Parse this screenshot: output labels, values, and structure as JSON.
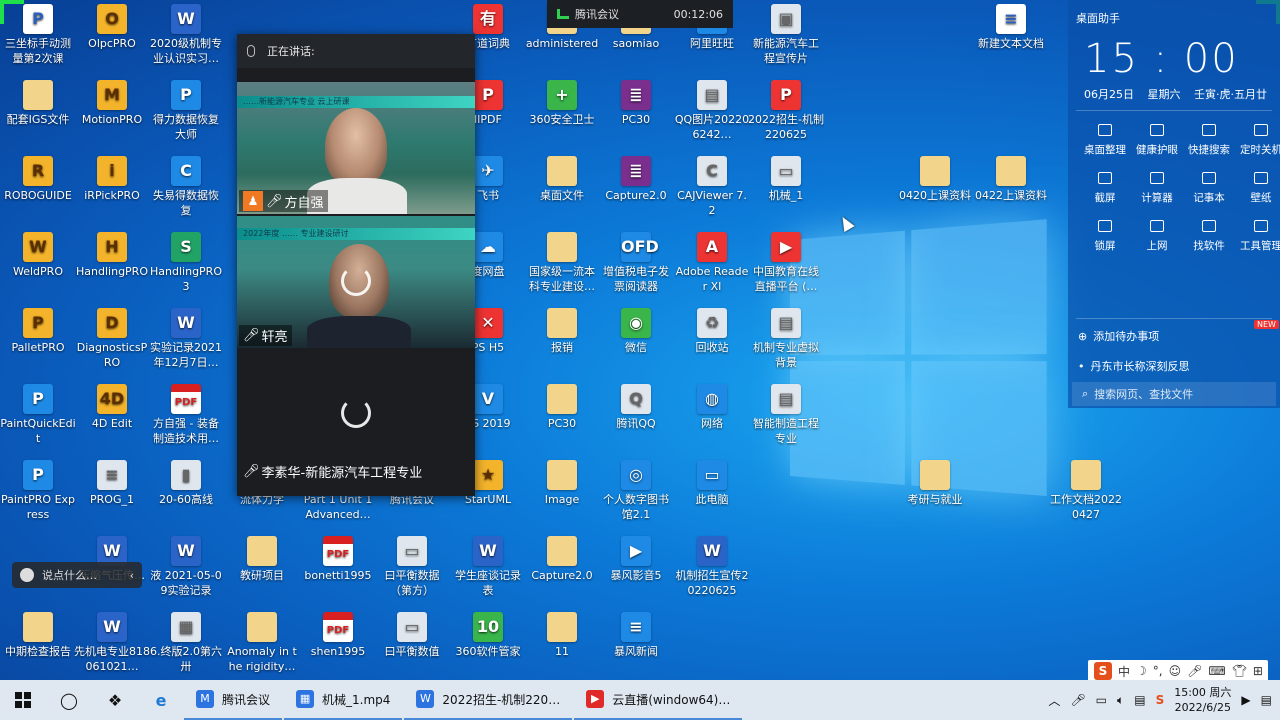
{
  "topbar": {
    "label": "腾讯会议",
    "time": "00:12:06"
  },
  "meeting": {
    "header": "正在讲话:",
    "tiles": [
      {
        "name": "方自强",
        "banner": "……新能源汽车专业 云上研课"
      },
      {
        "name": "轩亮",
        "banner": "2022年度 …… 专业建设研讨"
      },
      {
        "name": "李素华-新能源汽车工程专业"
      }
    ]
  },
  "icons": [
    {
      "label": "三坐标手动测量第2次课",
      "type": "g-doc",
      "g": "P"
    },
    {
      "label": "OlpcPRO",
      "type": "g-app",
      "g": "O"
    },
    {
      "label": "2020级机制专业认识实习…",
      "type": "g-word",
      "g": "W"
    },
    {
      "label": "有道词典",
      "type": "g-red",
      "g": "有"
    },
    {
      "label": "administered",
      "type": "g-folder",
      "g": ""
    },
    {
      "label": "saomiao",
      "type": "g-folder",
      "g": ""
    },
    {
      "label": "阿里旺旺",
      "type": "g-blue",
      "g": "旺"
    },
    {
      "label": "新能源汽车工程宣传片",
      "type": "g-gray",
      "g": "▣"
    },
    {
      "label": "新建文本文档",
      "type": "g-doc",
      "g": "≡"
    },
    {
      "label": "配套IGS文件",
      "type": "g-folder",
      "g": ""
    },
    {
      "label": "MotionPRO",
      "type": "g-app",
      "g": "M"
    },
    {
      "label": "得力数据恢复大师",
      "type": "g-blue",
      "g": "P"
    },
    {
      "label": "lIPDF",
      "type": "g-red",
      "g": "P"
    },
    {
      "label": "360安全卫士",
      "type": "g-green",
      "g": "+"
    },
    {
      "label": "PC30",
      "type": "g-rar",
      "g": "≣"
    },
    {
      "label": "QQ图片202206242…",
      "type": "g-gray",
      "g": "▤"
    },
    {
      "label": "2022招生-机制220625",
      "type": "g-red",
      "g": "P"
    },
    {
      "label": "ROBOGUIDE",
      "type": "g-app",
      "g": "R"
    },
    {
      "label": "iRPickPRO",
      "type": "g-app",
      "g": "i"
    },
    {
      "label": "失易得数据恢复",
      "type": "g-blue",
      "g": "C"
    },
    {
      "label": "飞书",
      "type": "g-blue",
      "g": "✈"
    },
    {
      "label": "桌面文件",
      "type": "g-folder",
      "g": ""
    },
    {
      "label": "Capture2.0",
      "type": "g-rar",
      "g": "≣"
    },
    {
      "label": "CAJViewer 7.2",
      "type": "g-gray",
      "g": "C"
    },
    {
      "label": "机械_1",
      "type": "g-gray",
      "g": "▭"
    },
    {
      "label": "0420上课资料",
      "type": "g-folder",
      "g": ""
    },
    {
      "label": "0422上课资料",
      "type": "g-folder",
      "g": ""
    },
    {
      "label": "WeldPRO",
      "type": "g-app",
      "g": "W"
    },
    {
      "label": "HandlingPRO",
      "type": "g-app",
      "g": "H"
    },
    {
      "label": "HandlingPRO 3",
      "type": "g-excel",
      "g": "S"
    },
    {
      "label": "度网盘",
      "type": "g-blue",
      "g": "☁"
    },
    {
      "label": "国家级一流本科专业建设…",
      "type": "g-folder",
      "g": ""
    },
    {
      "label": "增值税电子发票阅读器",
      "type": "g-blue",
      "g": "OFD"
    },
    {
      "label": "Adobe Reader XI",
      "type": "g-red",
      "g": "A"
    },
    {
      "label": "中国教育在线直播平台 (…",
      "type": "g-red",
      "g": "▶"
    },
    {
      "label": "PalletPRO",
      "type": "g-app",
      "g": "P"
    },
    {
      "label": "DiagnosticsPRO",
      "type": "g-app",
      "g": "D"
    },
    {
      "label": "实验记录2021年12月7日…",
      "type": "g-word",
      "g": "W"
    },
    {
      "label": "PS H5",
      "type": "g-red",
      "g": "✕"
    },
    {
      "label": "报销",
      "type": "g-folder",
      "g": ""
    },
    {
      "label": "微信",
      "type": "g-green",
      "g": "◉"
    },
    {
      "label": "回收站",
      "type": "g-gray",
      "g": "♻"
    },
    {
      "label": "机制专业虚拟背景",
      "type": "g-gray",
      "g": "▤"
    },
    {
      "label": "PaintQuickEdit",
      "type": "g-blue",
      "g": "P"
    },
    {
      "label": "4D Edit",
      "type": "g-app",
      "g": "4D"
    },
    {
      "label": "方自强 - 装备制造技术用…",
      "type": "g-pdf",
      "g": "PDF"
    },
    {
      "label": "PS 2019",
      "type": "g-blue",
      "g": "V"
    },
    {
      "label": "PC30",
      "type": "g-folder",
      "g": ""
    },
    {
      "label": "腾讯QQ",
      "type": "g-gray",
      "g": "Q"
    },
    {
      "label": "网络",
      "type": "g-blue",
      "g": "◍"
    },
    {
      "label": "智能制造工程专业",
      "type": "g-gray",
      "g": "▤"
    },
    {
      "label": "PaintPRO Express",
      "type": "g-blue",
      "g": "P"
    },
    {
      "label": "PROG_1",
      "type": "g-gray",
      "g": "≡"
    },
    {
      "label": "20-60高线",
      "type": "g-gray",
      "g": "▮"
    },
    {
      "label": "流体力学",
      "type": "g-folder",
      "g": ""
    },
    {
      "label": "Part 1 Unit 1 Advanced…",
      "type": "g-folder",
      "g": ""
    },
    {
      "label": "腾讯会议",
      "type": "g-blue",
      "g": "M"
    },
    {
      "label": "StarUML",
      "type": "g-app",
      "g": "★"
    },
    {
      "label": "Image",
      "type": "g-folder",
      "g": ""
    },
    {
      "label": "个人数字图书馆2.1",
      "type": "g-blue",
      "g": "◎"
    },
    {
      "label": "此电脑",
      "type": "g-blue",
      "g": "▭"
    },
    {
      "label": "考研与就业",
      "type": "g-folder",
      "g": ""
    },
    {
      "label": "工作文档20220427",
      "type": "g-folder",
      "g": ""
    },
    {
      "label": "压缩气压传…",
      "type": "g-word",
      "g": "W"
    },
    {
      "label": "液 2021-05-09实验记录",
      "type": "g-word",
      "g": "W"
    },
    {
      "label": "教研项目",
      "type": "g-folder",
      "g": ""
    },
    {
      "label": "bonetti1995",
      "type": "g-pdf",
      "g": "PDF"
    },
    {
      "label": "曰平衡数据（第方）",
      "type": "g-gray",
      "g": "▭"
    },
    {
      "label": "学生座谈记录表",
      "type": "g-word",
      "g": "W"
    },
    {
      "label": "Capture2.0",
      "type": "g-folder",
      "g": ""
    },
    {
      "label": "暴风影音5",
      "type": "g-blue",
      "g": "▶"
    },
    {
      "label": "机制招生宣传20220625",
      "type": "g-word",
      "g": "W"
    },
    {
      "label": "中期检查报告",
      "type": "g-folder",
      "g": ""
    },
    {
      "label": "先机电专业818061021…",
      "type": "g-word",
      "g": "W"
    },
    {
      "label": "6.终版2.0第六卅",
      "type": "g-gray",
      "g": "▦"
    },
    {
      "label": "Anomaly in the rigidity…",
      "type": "g-folder",
      "g": ""
    },
    {
      "label": "shen1995",
      "type": "g-pdf",
      "g": "PDF"
    },
    {
      "label": "曰平衡数值",
      "type": "g-gray",
      "g": "▭"
    },
    {
      "label": "360软件管家",
      "type": "g-green",
      "g": "10"
    },
    {
      "label": "11",
      "type": "g-folder",
      "g": ""
    },
    {
      "label": "暴风新闻",
      "type": "g-blue",
      "g": "≡"
    }
  ],
  "assistant": {
    "title": "桌面助手",
    "clock": "15 : 00",
    "date": "06月25日 星期六 壬寅·虎·五月廿",
    "tools": [
      "桌面整理",
      "健康护眼",
      "快捷搜索",
      "定时关机",
      "截屏",
      "计算器",
      "记事本",
      "壁纸",
      "锁屏",
      "上网",
      "找软件",
      "工具管理"
    ],
    "todo": "添加待办事项",
    "news": "丹东市长称深刻反思",
    "search_placeholder": "搜索网页、查找文件",
    "new_badge": "NEW"
  },
  "chatpill": {
    "placeholder": "说点什么…"
  },
  "taskbar": {
    "apps": [
      {
        "label": "腾讯会议",
        "color": "#2d74e0",
        "g": "M"
      },
      {
        "label": "机械_1.mp4",
        "color": "#2d74e0",
        "g": "▦"
      },
      {
        "label": "2022招生-机制220…",
        "color": "#2d74e0",
        "g": "W"
      },
      {
        "label": "云直播(window64)…",
        "color": "#e02a2a",
        "g": "▶"
      }
    ],
    "time": "15:00 周六",
    "date": "2022/6/25"
  },
  "ime": {
    "mode": "中"
  }
}
